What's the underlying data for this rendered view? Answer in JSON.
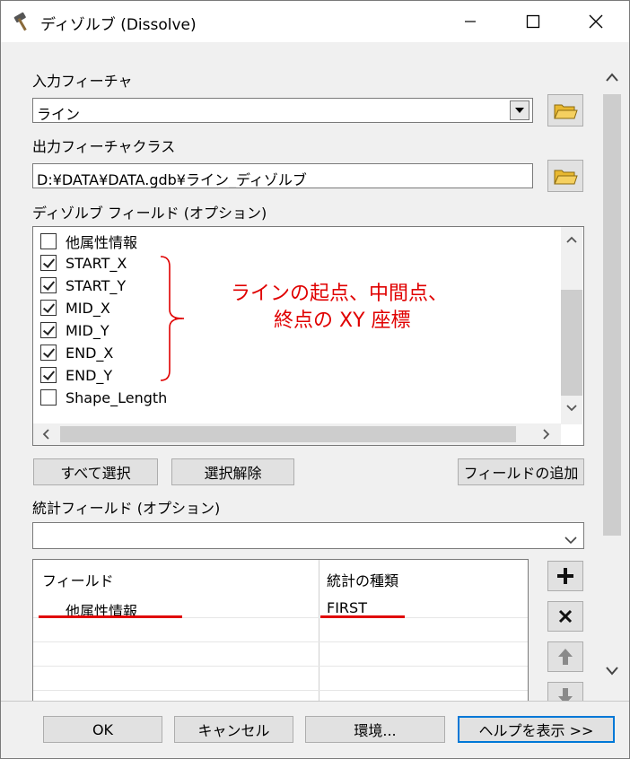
{
  "window": {
    "title": "ディゾルブ (Dissolve)",
    "minimize_icon": "minimize-icon",
    "maximize_icon": "maximize-icon",
    "close_icon": "close-icon"
  },
  "input_features": {
    "label": "入力フィーチャ",
    "value": "ライン"
  },
  "output_feature_class": {
    "label": "出力フィーチャクラス",
    "value": "D:¥DATA¥DATA.gdb¥ライン_ディゾルブ"
  },
  "dissolve_fields": {
    "label": "ディゾルブ フィールド (オプション)",
    "items": [
      {
        "label": "他属性情報",
        "checked": false
      },
      {
        "label": "START_X",
        "checked": true
      },
      {
        "label": "START_Y",
        "checked": true
      },
      {
        "label": "MID_X",
        "checked": true
      },
      {
        "label": "MID_Y",
        "checked": true
      },
      {
        "label": "END_X",
        "checked": true
      },
      {
        "label": "END_Y",
        "checked": true
      },
      {
        "label": "Shape_Length",
        "checked": false
      }
    ],
    "annotation_line1": "ラインの起点、中間点、",
    "annotation_line2": "終点の XY 座標",
    "select_all": "すべて選択",
    "clear_all": "選択解除",
    "add_field": "フィールドの追加"
  },
  "statistics_fields": {
    "label": "統計フィールド (オプション)",
    "headers": [
      "フィールド",
      "統計の種類"
    ],
    "rows": [
      {
        "field": "他属性情報",
        "type": "FIRST"
      }
    ]
  },
  "buttons": {
    "ok": "OK",
    "cancel": "キャンセル",
    "environments": "環境...",
    "show_help": "ヘルプを表示 >>"
  },
  "colors": {
    "annotation": "#e00000",
    "focus_border": "#0078d7"
  }
}
